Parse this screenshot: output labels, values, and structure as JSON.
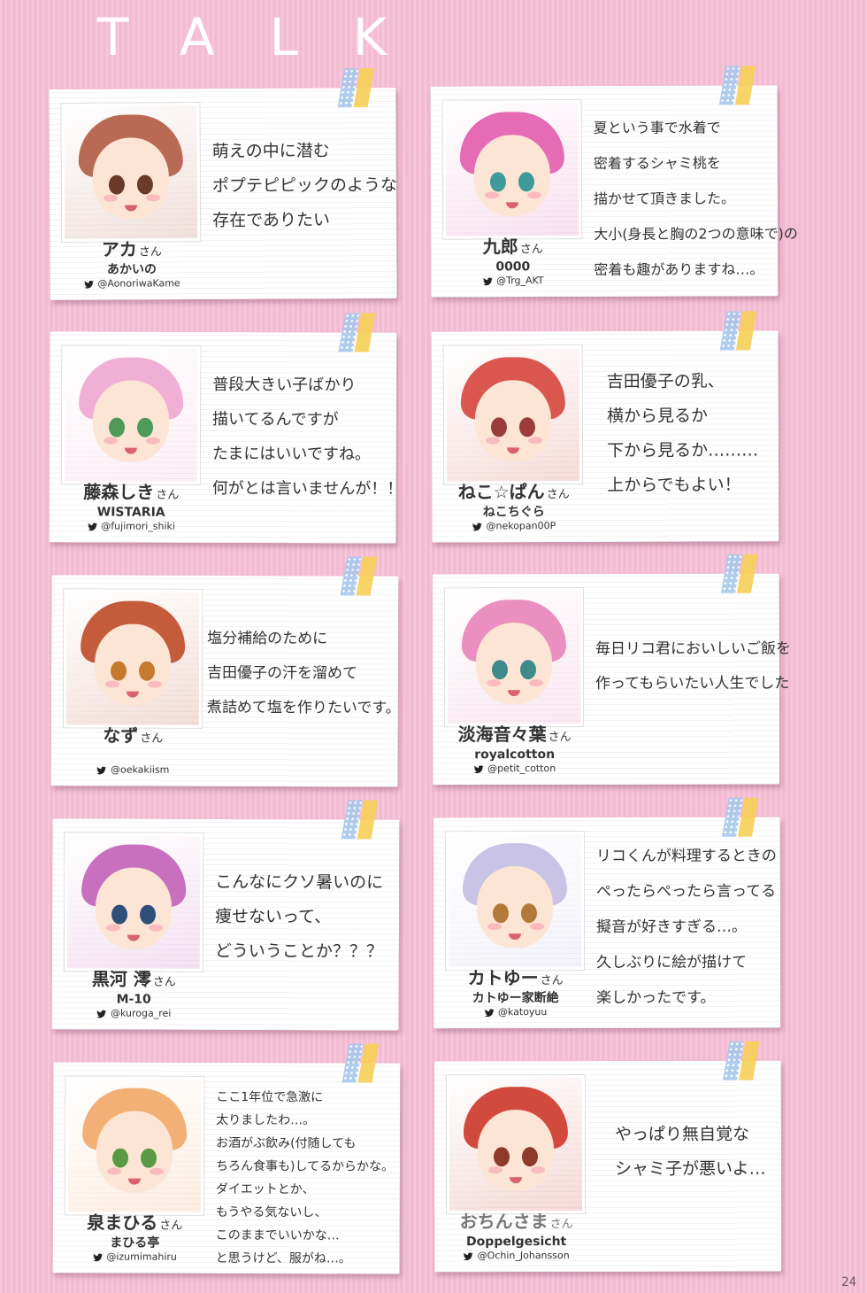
{
  "page": {
    "title": "TALK",
    "page_number": "24"
  },
  "san_suffix": "さん",
  "cards": [
    {
      "name": "アカ",
      "circle": "あかいの",
      "handle": "@AonoriwaKame",
      "comment": [
        "萌えの中に潜む",
        "ポプテピピックのような",
        "存在でありたい"
      ],
      "hair_color": "#b86a55",
      "eye_color": "#6b3a2a"
    },
    {
      "name": "九郎",
      "circle": "0000",
      "handle": "@Trg_AKT",
      "comment": [
        "夏という事で水着で",
        "密着するシャミ桃を",
        "描かせて頂きました。",
        "大小(身長と胸の2つの意味で)の",
        "密着も趣がありますね…。"
      ],
      "hair_color": "#e46bb4",
      "eye_color": "#3f9a9a"
    },
    {
      "name": "藤森しき",
      "circle": "WISTARIA",
      "handle": "@fujimori_shiki",
      "comment": [
        "普段大きい子ばかり",
        "描いてるんですが",
        "たまにはいいですね。",
        "何がとは言いませんが！！"
      ],
      "hair_color": "#f0b0d6",
      "eye_color": "#4d9a5b"
    },
    {
      "name": "ねこ☆ぱん",
      "circle": "ねこちぐら",
      "handle": "@nekopan00P",
      "comment": [
        "吉田優子の乳、",
        "横から見るか",
        "下から見るか………",
        "上からでもよい！"
      ],
      "hair_color": "#d9574f",
      "eye_color": "#9b3b3b"
    },
    {
      "name": "なず",
      "circle": "",
      "handle": "@oekakiism",
      "comment": [
        "塩分補給のために",
        "吉田優子の汗を溜めて",
        "煮詰めて塩を作りたいです。"
      ],
      "hair_color": "#c45c3c",
      "eye_color": "#c77a2e"
    },
    {
      "name": "淡海音々葉",
      "circle": "royalcotton",
      "handle": "@petit_cotton",
      "comment": [
        "毎日リコ君においしいご飯を",
        "作ってもらいたい人生でした"
      ],
      "hair_color": "#ea8fbf",
      "eye_color": "#3f8a8a"
    },
    {
      "name": "黒河 澪",
      "circle": "M-10",
      "handle": "@kuroga_rei",
      "comment": [
        "こんなにクソ暑いのに",
        "痩せないって、",
        "どういうことか？？？"
      ],
      "hair_color": "#c86fbe",
      "eye_color": "#2f4f7a"
    },
    {
      "name": "カトゆー",
      "circle": "カトゆー家断絶",
      "handle": "@katoyuu",
      "comment": [
        "リコくんが料理するときの",
        "ぺったらぺったら言ってる",
        "擬音が好きすぎる…。",
        "久しぶりに絵が描けて",
        "楽しかったです。"
      ],
      "hair_color": "#c9c3e6",
      "eye_color": "#b27a3a"
    },
    {
      "name": "泉まひる",
      "circle": "まひる亭",
      "handle": "@izumimahiru",
      "comment": [
        "ここ1年位で急激に",
        "太りましたわ…。",
        "お酒がぶ飲み(付随しても",
        "ちろん食事も)してるからかな。",
        "ダイエットとか、",
        "もうやる気ないし、",
        "このままでいいかな…",
        "と思うけど、服がね…。"
      ],
      "hair_color": "#f2b077",
      "eye_color": "#5b9a45"
    },
    {
      "name": "おちんさま",
      "circle": "Doppelgesicht",
      "handle": "@Ochin_Johansson",
      "comment": [
        "やっぱり無自覚な",
        "シャミ子が悪いよ…"
      ],
      "hair_color": "#d2493d",
      "eye_color": "#8e3a2a"
    }
  ]
}
